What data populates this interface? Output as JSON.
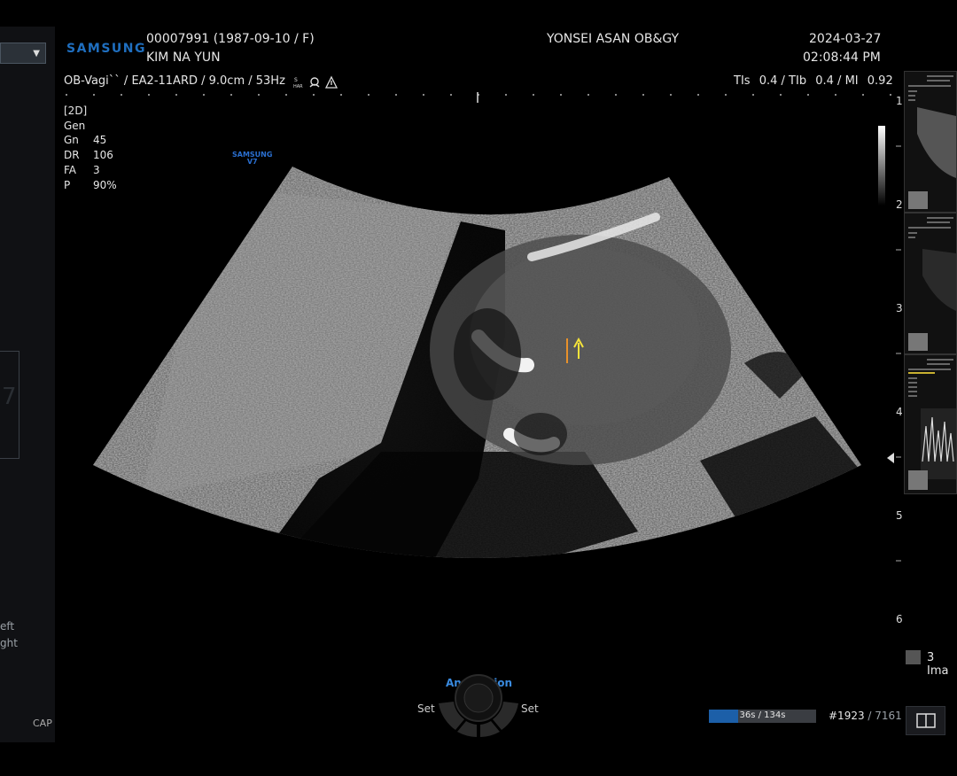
{
  "header": {
    "brand": "SAMSUNG",
    "patient_id": "00007991 (1987-09-10 / F)",
    "patient_name": "KIM NA YUN",
    "institution": "YONSEI ASAN OB&GY",
    "date": "2024-03-27",
    "time": "02:08:44 PM",
    "preset_line": "OB-Vagi`` / EA2-11ARD / 9.0cm / 53Hz",
    "preset_icons": [
      "s-har-icon",
      "fetus-icon",
      "alert-triangle-icon"
    ],
    "safety": {
      "tis_label": "TIs",
      "tis_value": "0.4",
      "tib_label": "TIb",
      "tib_value": "0.4",
      "mi_label": "MI",
      "mi_value": "0.92"
    }
  },
  "params": {
    "mode": "[2D]",
    "preset": "Gen",
    "rows": [
      {
        "key": "Gn",
        "value": "45"
      },
      {
        "key": "DR",
        "value": "106"
      },
      {
        "key": "FA",
        "value": "3"
      },
      {
        "key": "P",
        "value": "90%"
      }
    ]
  },
  "image_logo": {
    "line1": "SAMSUNG",
    "line2": "V7"
  },
  "left_panel": {
    "option1": "eft",
    "option2": "ght",
    "cap_label": "CAP"
  },
  "depth_scale": [
    "1",
    "2",
    "3",
    "4",
    "5",
    "6"
  ],
  "thumbnails": {
    "count_label": "3 Ima"
  },
  "cine": {
    "progress_text": "36s / 134s",
    "progress_fraction": 0.27,
    "frame_current": "#1923",
    "frame_total": "/ 7161"
  },
  "trackball": {
    "title": "Annotation",
    "left_label": "Set",
    "right_label": "Set"
  },
  "colors": {
    "brand_blue": "#1f6fc0",
    "annotation_blue": "#3a8be0",
    "marker_yellow": "#f5e33a",
    "marker_orange": "#e8912a",
    "progress_fill": "#1c5fa8"
  }
}
